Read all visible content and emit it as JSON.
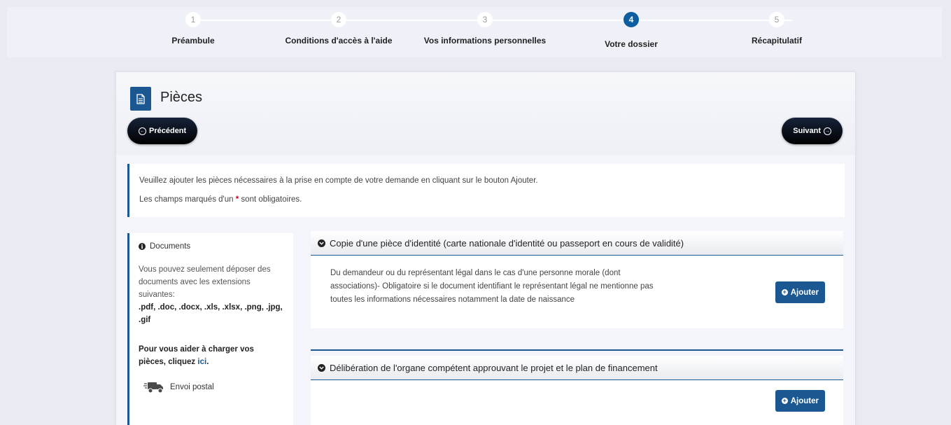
{
  "stepper": {
    "steps": [
      {
        "number": "1",
        "label": "Préambule"
      },
      {
        "number": "2",
        "label": "Conditions d'accès à l'aide"
      },
      {
        "number": "3",
        "label": "Vos informations personnelles"
      },
      {
        "number": "4",
        "label": "Votre dossier"
      },
      {
        "number": "5",
        "label": "Récapitulatif"
      }
    ],
    "active_step": 4
  },
  "page": {
    "title": "Pièces",
    "prev_label": "Précédent",
    "next_label": "Suivant"
  },
  "info": {
    "line1": "Veuillez ajouter les pièces nécessaires à la prise en compte de votre demande en cliquant sur le bouton Ajouter.",
    "line2_prefix": "Les champs marqués d'un",
    "required_mark": "*",
    "line2_suffix": "sont obligatoires."
  },
  "sidebar": {
    "title": "Documents",
    "text": "Vous pouvez seulement déposer des documents avec les extensions suivantes:",
    "extensions": ".pdf, .doc, .docx, .xls, .xlsx, .png, .jpg, .gif",
    "help_text": "Pour vous aider à charger vos pièces, cliquez",
    "help_link": "ici",
    "help_end": ".",
    "postal_label": "Envoi postal"
  },
  "documents": [
    {
      "title": "Copie d'une pièce d'identité (carte nationale d'identité ou passeport en cours de validité)",
      "description": "Du demandeur ou du représentant légal dans le cas d'une personne morale (dont associations)- Obligatoire si le document identifiant le représentant légal ne mentionne pas toutes les informations nécessaires notamment la date de naissance",
      "add_label": "Ajouter"
    },
    {
      "title": "Délibération de l'organe compétent approuvant le projet et le plan de financement",
      "description": "",
      "add_label": "Ajouter"
    }
  ],
  "colors": {
    "primary": "#1b5791",
    "active_step": "#0d5ea0",
    "required": "#d0021b"
  }
}
